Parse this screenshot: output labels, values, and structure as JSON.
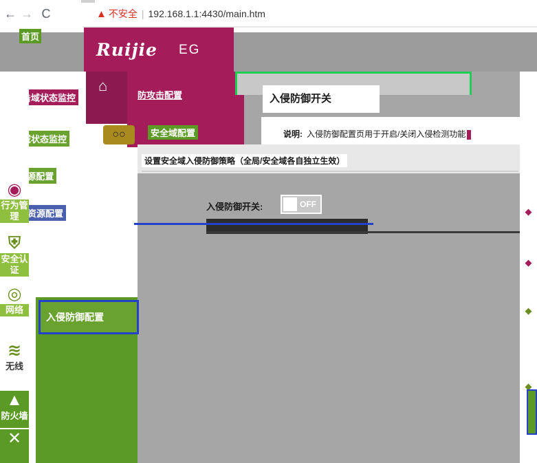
{
  "browser": {
    "back_glyph": "←",
    "forward_glyph": "→",
    "reload_glyph": "C",
    "warning_glyph": "▲",
    "insecure_label": "不安全",
    "separator": "|",
    "url": "192.168.1.1:4430/main.htm"
  },
  "header": {
    "logo": "Ruijie",
    "model": "EG"
  },
  "home": {
    "icon": "⌂",
    "label": "首页"
  },
  "top_menu": {
    "items": [
      "防攻击配置",
      "安全域配置"
    ],
    "zone_icon": "○○"
  },
  "primary_nav": [
    {
      "icon": "shield-icon",
      "glyph": "◉",
      "label": "行为管理"
    },
    {
      "icon": "shield-icon",
      "glyph": "⛨",
      "label": "安全认证"
    },
    {
      "icon": "network-icon",
      "glyph": "◎",
      "label": "网络"
    },
    {
      "icon": "wifi-icon",
      "glyph": "≋",
      "label": "无线"
    },
    {
      "icon": "firewall-icon",
      "glyph": "▲",
      "label": "防火墙"
    },
    {
      "icon": "tools-icon",
      "glyph": "✕",
      "label": ""
    }
  ],
  "secondary_nav": {
    "items": [
      "防攻击域状态监控",
      "安全域状态监控",
      "IP资源配置",
      "服务资源配置"
    ],
    "active": "入侵防御配置"
  },
  "panel": {
    "title": "入侵防御开关",
    "note_label": "说明:",
    "note_text": "入侵防御配置页用于开启/关闭入侵检测功能",
    "tab_strip": "设置安全域入侵防御策略（全局/安全域各自独立生效）",
    "switch_label": "入侵防御开关:",
    "switch_state": "OFF"
  },
  "colors": {
    "brand": "#a51c5b",
    "nav_green": "#5a9a25",
    "highlight_blue": "#2342c9",
    "frame_green": "#1fcc54"
  }
}
